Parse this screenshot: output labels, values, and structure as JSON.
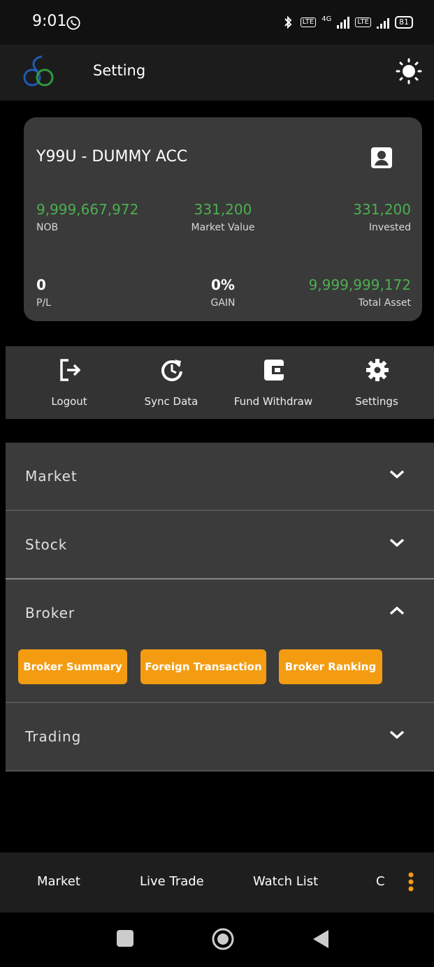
{
  "status": {
    "time": "9:01",
    "network": "4G",
    "lte": "LTE",
    "battery": "81"
  },
  "appbar": {
    "title": "Setting"
  },
  "account": {
    "name": "Y99U - DUMMY ACC",
    "nob": {
      "value": "9,999,667,972",
      "label": "NOB"
    },
    "market_value": {
      "value": "331,200",
      "label": "Market Value"
    },
    "invested": {
      "value": "331,200",
      "label": "Invested"
    },
    "pl": {
      "value": "0",
      "label": "P/L"
    },
    "gain": {
      "value": "0%",
      "label": "GAIN"
    },
    "total_asset": {
      "value": "9,999,999,172",
      "label": "Total Asset"
    }
  },
  "actions": [
    {
      "label": "Logout",
      "icon": "logout-icon"
    },
    {
      "label": "Sync Data",
      "icon": "sync-icon"
    },
    {
      "label": "Fund Withdraw",
      "icon": "wallet-icon"
    },
    {
      "label": "Settings",
      "icon": "gear-icon"
    }
  ],
  "sections": [
    {
      "label": "Market",
      "expanded": false
    },
    {
      "label": "Stock",
      "expanded": false
    },
    {
      "label": "Broker",
      "expanded": true,
      "chips": [
        "Broker Summary",
        "Foreign Transaction",
        "Broker Ranking"
      ]
    },
    {
      "label": "Trading",
      "expanded": false
    }
  ],
  "bottom_nav": [
    "Market",
    "Live Trade",
    "Watch List",
    "C"
  ],
  "colors": {
    "accent": "#f39c12",
    "positive": "#4caf50",
    "card": "#3a3a3a"
  }
}
